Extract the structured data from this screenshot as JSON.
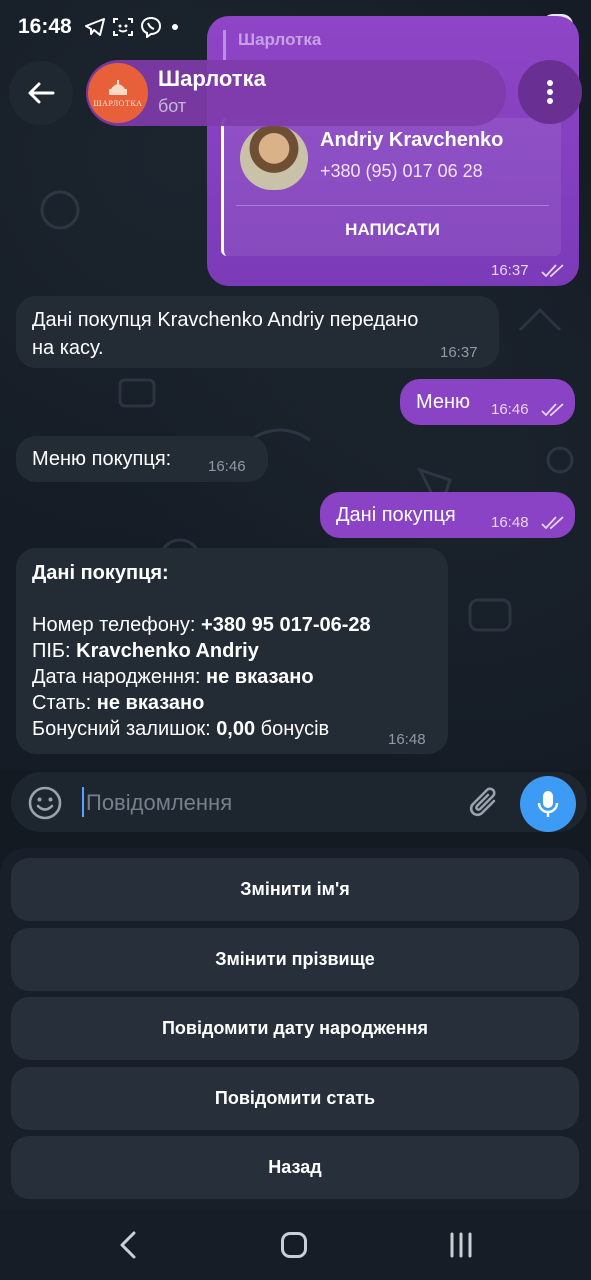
{
  "status_bar": {
    "time": "16:48",
    "battery": "93"
  },
  "header": {
    "back_icon": "arrow-left-icon",
    "avatar_text": "ШАРЛОТКА",
    "title": "Шарлотка",
    "subtitle": "бот",
    "menu_icon": "more-vertical-icon"
  },
  "messages": {
    "contact": {
      "quoted_name": "Шарлотка",
      "name": "Andriy Kravchenko",
      "phone": "+380 (95) 017 06 28",
      "action": "НАПИСАТИ",
      "time": "16:37"
    },
    "msg1": {
      "line1": "Дані покупця Kravchenko Andriy передано",
      "line2": "на касу.",
      "time": "16:37"
    },
    "msg2": {
      "text": "Меню",
      "time": "16:46"
    },
    "msg3": {
      "text": "Меню покупця:",
      "time": "16:46"
    },
    "msg4": {
      "text": "Дані покупця",
      "time": "16:48"
    },
    "msg5": {
      "title": "Дані покупця:",
      "phone_label": "Номер телефону: ",
      "phone_value": "+380 95 017-06-28",
      "name_label": "ПІБ: ",
      "name_value": "Kravchenko Andriy",
      "birth_label": "Дата народження: ",
      "birth_value": "не вказано",
      "gender_label": "Стать: ",
      "gender_value": "не вказано",
      "bonus_label": "Бонусний залишок: ",
      "bonus_value": "0,00",
      "bonus_suffix": " бонусів",
      "time": "16:48"
    }
  },
  "composer": {
    "placeholder": "Повідомлення",
    "emoji_icon": "smile-icon",
    "attach_icon": "paperclip-icon",
    "mic_icon": "microphone-icon"
  },
  "keyboard": {
    "buttons": [
      "Змінити ім'я",
      "Змінити прізвище",
      "Повідомити дату народження",
      "Повідомити стать",
      "Назад"
    ]
  },
  "colors": {
    "accent_purple": "#8a43c4",
    "mic_blue": "#3e9bf5",
    "incoming_bubble": "#232b35"
  }
}
